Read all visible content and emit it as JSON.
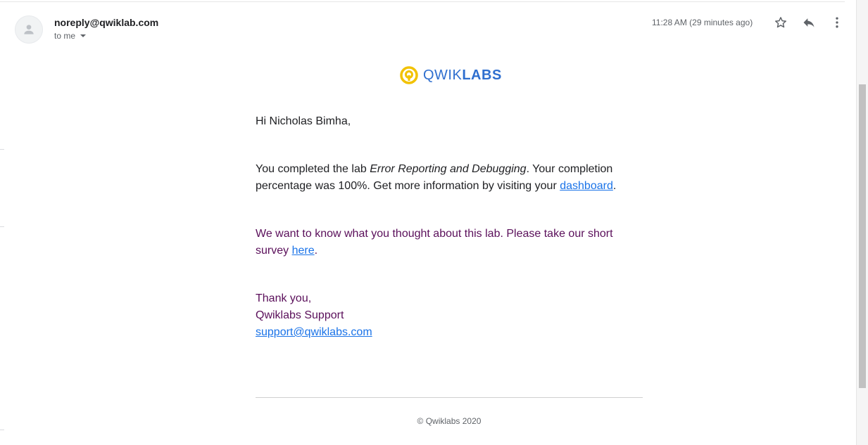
{
  "header": {
    "sender": "noreply@qwiklab.com",
    "recipient": "to me",
    "timestamp": "11:28 AM (29 minutes ago)"
  },
  "logo": {
    "part1": "QWIK",
    "part2": "LABS"
  },
  "email": {
    "greeting": "Hi Nicholas Bimha,",
    "para1_before": "You completed the lab ",
    "lab_name": "Error Reporting and Debugging",
    "para1_middle": ". Your completion percentage was 100%. Get more information by visiting your ",
    "dashboard_link": "dashboard",
    "para1_end": ".",
    "para2_before": "We want to know what you thought about this lab. Please take our short survey ",
    "survey_link": "here",
    "para2_end": ".",
    "sign_thanks": "Thank you,",
    "sign_name": "Qwiklabs Support",
    "support_email": "support@qwiklabs.com"
  },
  "footer": {
    "copyright": "© Qwiklabs 2020"
  },
  "colors": {
    "brand_blue": "#2f6fcf",
    "brand_yellow": "#f2c200",
    "purple_text": "#5a0f5a",
    "link": "#1a73e8"
  },
  "icons": [
    "person-icon",
    "star-icon",
    "reply-icon",
    "more-vert-icon",
    "qwiklabs-logo-icon"
  ]
}
